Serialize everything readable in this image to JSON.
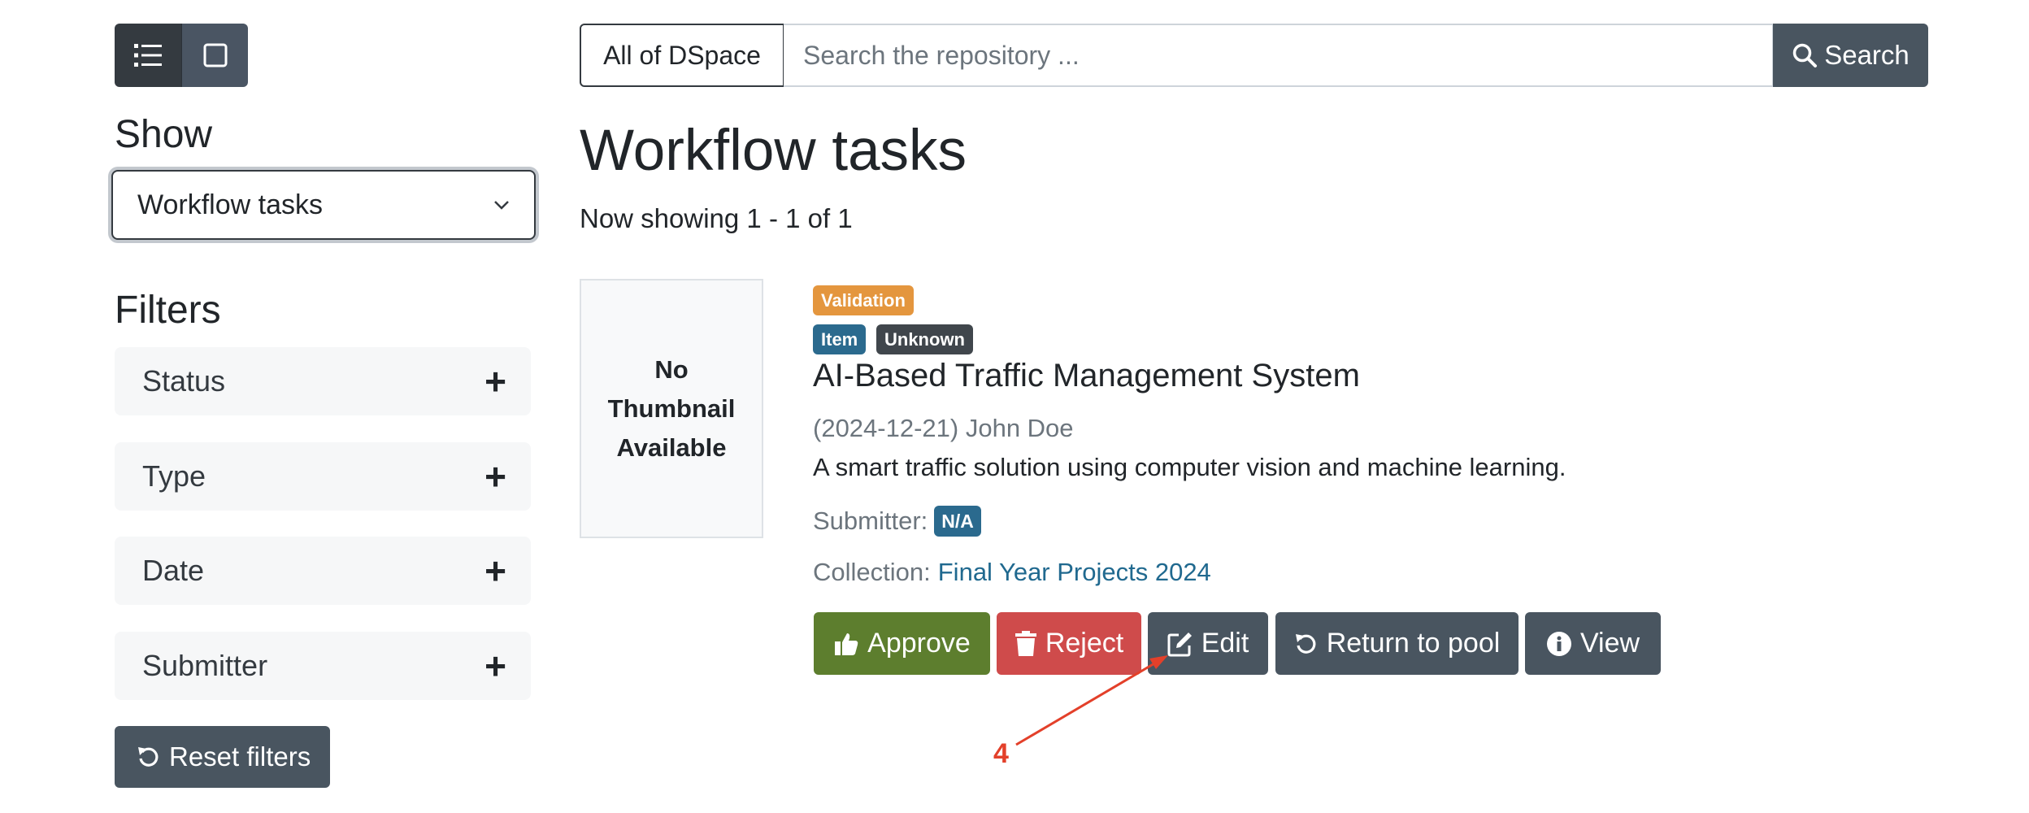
{
  "view_toggle": {
    "list_icon": "list-icon",
    "grid_icon": "grid-icon"
  },
  "sidebar": {
    "show_label": "Show",
    "show_select_value": "Workflow tasks",
    "filters_label": "Filters",
    "facets": [
      {
        "label": "Status"
      },
      {
        "label": "Type"
      },
      {
        "label": "Date"
      },
      {
        "label": "Submitter"
      }
    ],
    "reset_label": "Reset filters"
  },
  "search": {
    "scope_label": "All of DSpace",
    "placeholder": "Search the repository ...",
    "button_label": "Search"
  },
  "main": {
    "title": "Workflow tasks",
    "showing": "Now showing 1 - 1 of 1"
  },
  "item": {
    "thumbnail_text": [
      "No",
      "Thumbnail",
      "Available"
    ],
    "badges": {
      "status": "Validation",
      "type": "Item",
      "kind": "Unknown"
    },
    "title": "AI-Based Traffic Management System",
    "meta": "(2024-12-21) John Doe",
    "abstract": "A smart traffic solution using computer vision and machine learning.",
    "submitter_label": "Submitter:",
    "submitter_value": "N/A",
    "collection_label": "Collection:",
    "collection_value": "Final Year Projects 2024",
    "actions": {
      "approve": "Approve",
      "reject": "Reject",
      "edit": "Edit",
      "return": "Return to pool",
      "view": "View"
    }
  },
  "annotation": {
    "label": "4"
  },
  "colors": {
    "dark_button": "#495560",
    "approve": "#5d7e2e",
    "reject": "#cf4b4b",
    "validation_badge": "#e4963e",
    "item_badge": "#2b6a8e",
    "annotation": "#e3402a"
  }
}
